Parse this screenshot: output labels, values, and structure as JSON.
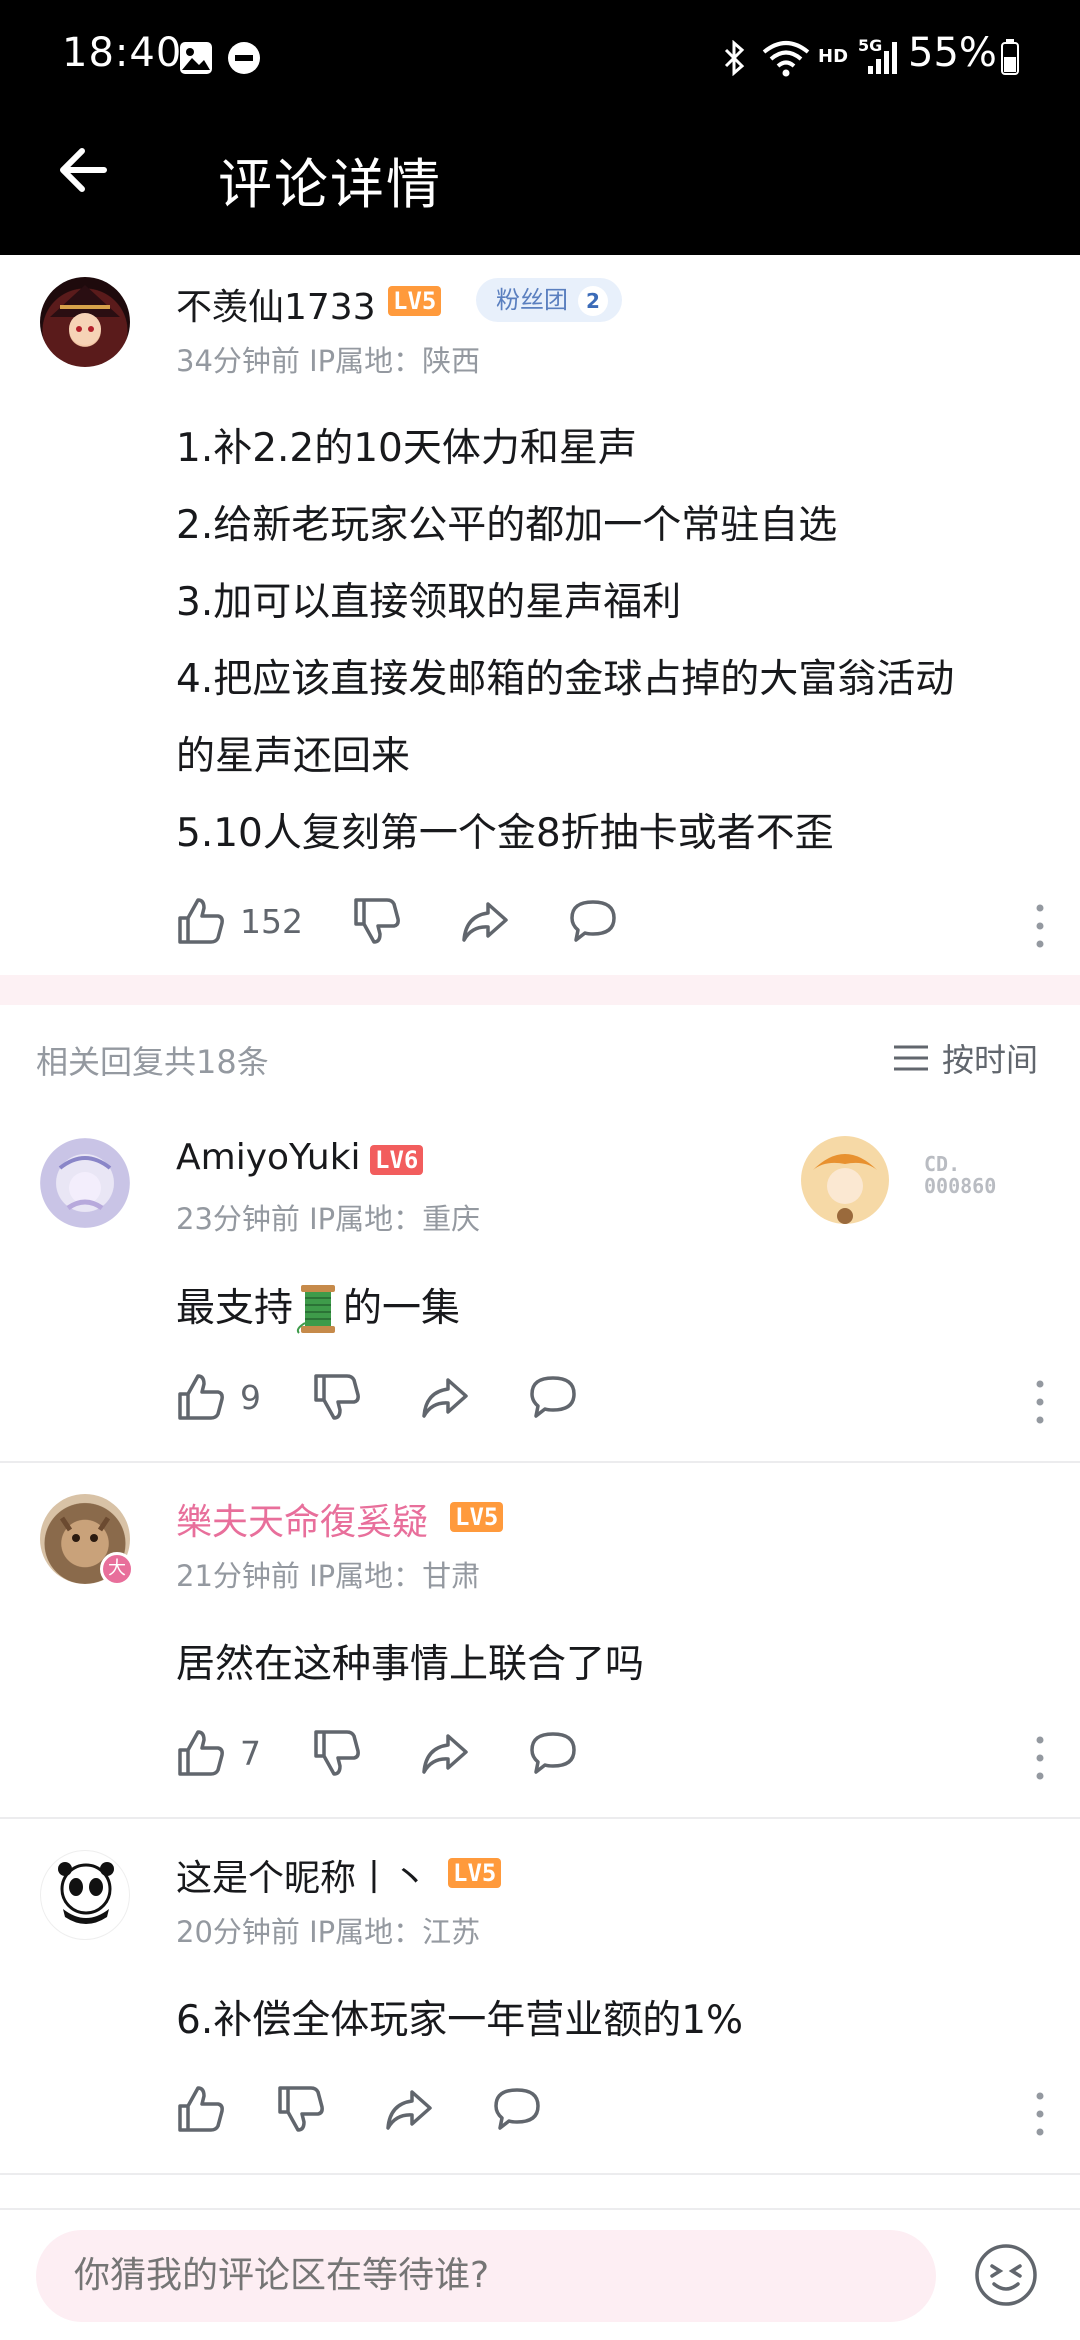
{
  "status_bar": {
    "time": "18:40",
    "network": "HD",
    "signal": "5G",
    "battery": "55%",
    "icons": [
      "image-icon",
      "minus-circle-icon",
      "bluetooth-icon",
      "wifi-icon",
      "signal-icon",
      "battery-icon"
    ]
  },
  "header": {
    "title": "评论详情",
    "back_icon": "arrow-left-icon"
  },
  "main_comment": {
    "username": "不羡仙1733",
    "level": "LV5",
    "fan_badge": {
      "label": "粉丝团",
      "level": "2"
    },
    "meta": "34分钟前 IP属地：陕西",
    "lines": [
      "1.补2.2的10天体力和星声",
      "2.给新老玩家公平的都加一个常驻自选",
      "3.加可以直接领取的星声福利",
      "4.把应该直接发邮箱的金球占掉的大富翁活动",
      "的星声还回来",
      "5.10人复刻第一个金8折抽卡或者不歪"
    ],
    "likes": "152"
  },
  "replies_header": {
    "count_text": "相关回复共18条",
    "sort_label": "按时间"
  },
  "replies": [
    {
      "username": "AmiyoYuki",
      "level": "LV6",
      "meta": "23分钟前 IP属地：重庆",
      "text_before": "最支持",
      "text_after": "的一集",
      "likes": "9",
      "card_prefix": "CD.",
      "card_number": "000860"
    },
    {
      "username": "樂夫天命復奚疑",
      "level": "LV5",
      "meta": "21分钟前 IP属地：甘肃",
      "text": "居然在这种事情上联合了吗",
      "likes": "7",
      "avatar_badge": "大"
    },
    {
      "username": "这是个昵称丨丶",
      "level": "LV5",
      "meta": "20分钟前 IP属地：江苏",
      "text": "6.补偿全体玩家一年营业额的1%",
      "likes": ""
    }
  ],
  "input": {
    "placeholder": "你猜我的评论区在等待谁?"
  },
  "colors": {
    "accent_pink": "#e86f9b",
    "level5": "#ff9a3c",
    "level6": "#f25d5d",
    "meta_gray": "#9499a0"
  }
}
